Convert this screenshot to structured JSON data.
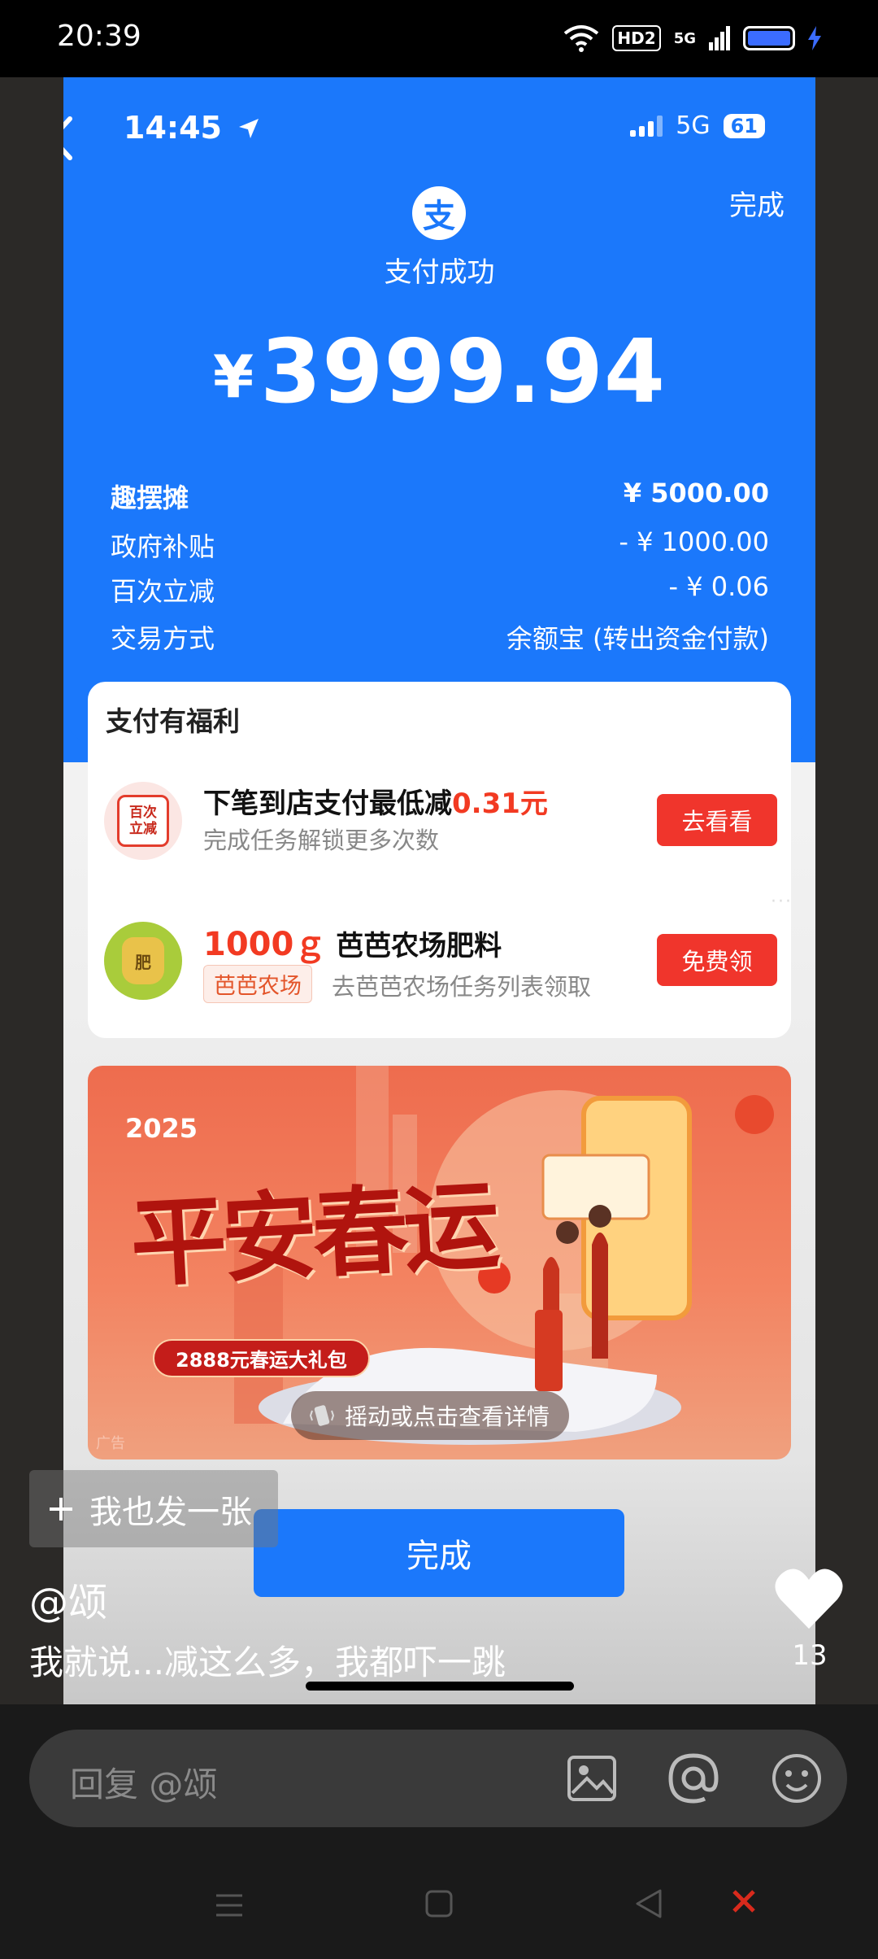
{
  "outer_status": {
    "time": "20:39",
    "hd": "HD2",
    "network": "5G"
  },
  "inner_status": {
    "time": "14:45",
    "network": "5G",
    "battery": "61"
  },
  "header": {
    "done": "完成",
    "logo_char": "支",
    "status": "支付成功"
  },
  "payment": {
    "currency": "¥",
    "amount": "3999.94",
    "rows": [
      {
        "label": "趣摆摊",
        "value": "¥ 5000.00"
      },
      {
        "label": "政府补贴",
        "value": "- ¥ 1000.00"
      },
      {
        "label": "百次立减",
        "value": "- ¥ 0.06"
      },
      {
        "label": "交易方式",
        "value": "余额宝 (转出资金付款)"
      }
    ]
  },
  "benefits": {
    "title": "支付有福利",
    "item1": {
      "icon_text": "百次\n立减",
      "title_prefix": "下笔到店支付最低减",
      "title_highlight": "0.31元",
      "subtitle": "完成任务解锁更多次数",
      "button": "去看看"
    },
    "item2": {
      "icon_text": "肥",
      "title_highlight": "1000ｇ",
      "title_suffix": "芭芭农场肥料",
      "tag": "芭芭农场",
      "subtitle": "去芭芭农场任务列表领取",
      "button": "免费领"
    }
  },
  "banner": {
    "year": "2025",
    "headline": "平安春运",
    "promo": "2888元春运大礼包",
    "ad": "广告",
    "hint": "摇动或点击查看详情"
  },
  "done_button": "完成",
  "post": {
    "cta": "我也发一张",
    "username": "@颂",
    "caption": "我就说...减这么多，我都吓一跳",
    "likes": "13"
  },
  "reply": {
    "placeholder": "回复 @颂"
  },
  "colors": {
    "alipay_blue": "#1b78fb",
    "accent_red": "#f0352c"
  }
}
